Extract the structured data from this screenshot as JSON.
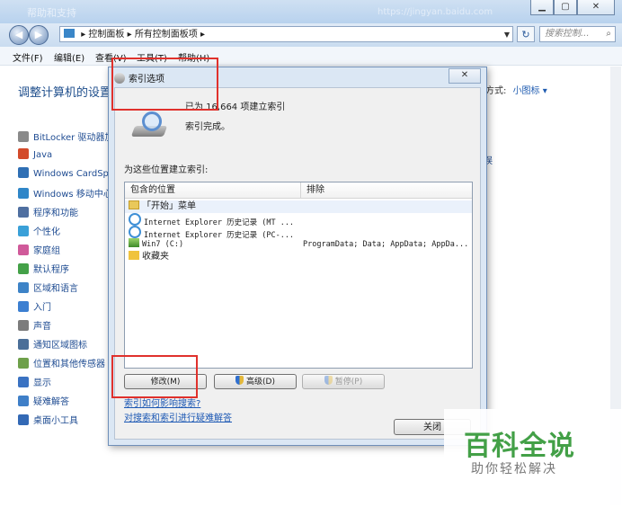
{
  "window": {
    "ghost_title": "帮助和支持",
    "ghost_url": "https://jingyan.baidu.com",
    "min_label": "▁",
    "max_label": "▢",
    "close_label": "✕"
  },
  "nav": {
    "back": "◀",
    "forward": "▶",
    "breadcrumb": [
      "控制面板",
      "所有控制面板项"
    ],
    "separator": "▸",
    "search_placeholder": "搜索控制...",
    "refresh": "↻"
  },
  "menubar": [
    "文件(F)",
    "编辑(E)",
    "查看(V)",
    "工具(T)",
    "帮助(H)"
  ],
  "main": {
    "heading": "调整计算机的设置",
    "view_by_label": "方式:",
    "view_by_value": "小图标 ▾",
    "right_fragment": "误",
    "items": [
      {
        "label": "BitLocker 驱动器加",
        "color": "#8a8a8a"
      },
      {
        "label": "Java",
        "color": "#d34a2a"
      },
      {
        "label": "Windows CardSp",
        "color": "#2f6fb4"
      },
      {
        "label": "Windows 移动中心",
        "color": "#2f86c8"
      },
      {
        "label": "程序和功能",
        "color": "#4f6fa0"
      },
      {
        "label": "个性化",
        "color": "#3aa0d8"
      },
      {
        "label": "家庭组",
        "color": "#d05a9a"
      },
      {
        "label": "默认程序",
        "color": "#44a148"
      },
      {
        "label": "区域和语言",
        "color": "#3d83c7"
      },
      {
        "label": "入门",
        "color": "#3c7fd1"
      },
      {
        "label": "声音",
        "color": "#7c7c7c"
      },
      {
        "label": "通知区域图标",
        "color": "#4b6f98"
      },
      {
        "label": "位置和其他传感器",
        "color": "#6ea04a"
      },
      {
        "label": "显示",
        "color": "#3a72c2"
      },
      {
        "label": "疑难解答",
        "color": "#3f7fc8"
      },
      {
        "label": "桌面小工具",
        "color": "#3369b5"
      }
    ]
  },
  "dialog": {
    "title": "索引选项",
    "close_label": "✕",
    "status_indexed": "已为 16,664 项建立索引",
    "status_done": "索引完成。",
    "locations_label": "为这些位置建立索引:",
    "col_included": "包含的位置",
    "col_excluded": "排除",
    "rows": [
      {
        "icon": "folder",
        "name": "「开始」菜单",
        "exclude": "",
        "cjk": true
      },
      {
        "icon": "ie",
        "name": "Internet Explorer 历史记录 (MT ...",
        "exclude": "",
        "cjk": false
      },
      {
        "icon": "ie",
        "name": "Internet Explorer 历史记录 (PC-...",
        "exclude": "",
        "cjk": false
      },
      {
        "icon": "drive",
        "name": "Win7 (C:)",
        "exclude": "ProgramData; Data; AppData; AppDa...",
        "cjk": false
      },
      {
        "icon": "star",
        "name": "收藏夹",
        "exclude": "",
        "cjk": true
      }
    ],
    "modify_button": "修改(M)",
    "advanced_button": "高级(D)",
    "pause_button": "暂停(P)",
    "link_how": "索引如何影响搜索?",
    "link_troubleshoot": "对搜索和索引进行疑难解答",
    "close_button": "关闭"
  },
  "watermark": {
    "title": "百科全说",
    "subtitle": "助你轻松解决"
  },
  "colors": {
    "annotation_red": "#e0312c",
    "link_blue": "#1c58b4",
    "watermark_green": "#43a047"
  }
}
